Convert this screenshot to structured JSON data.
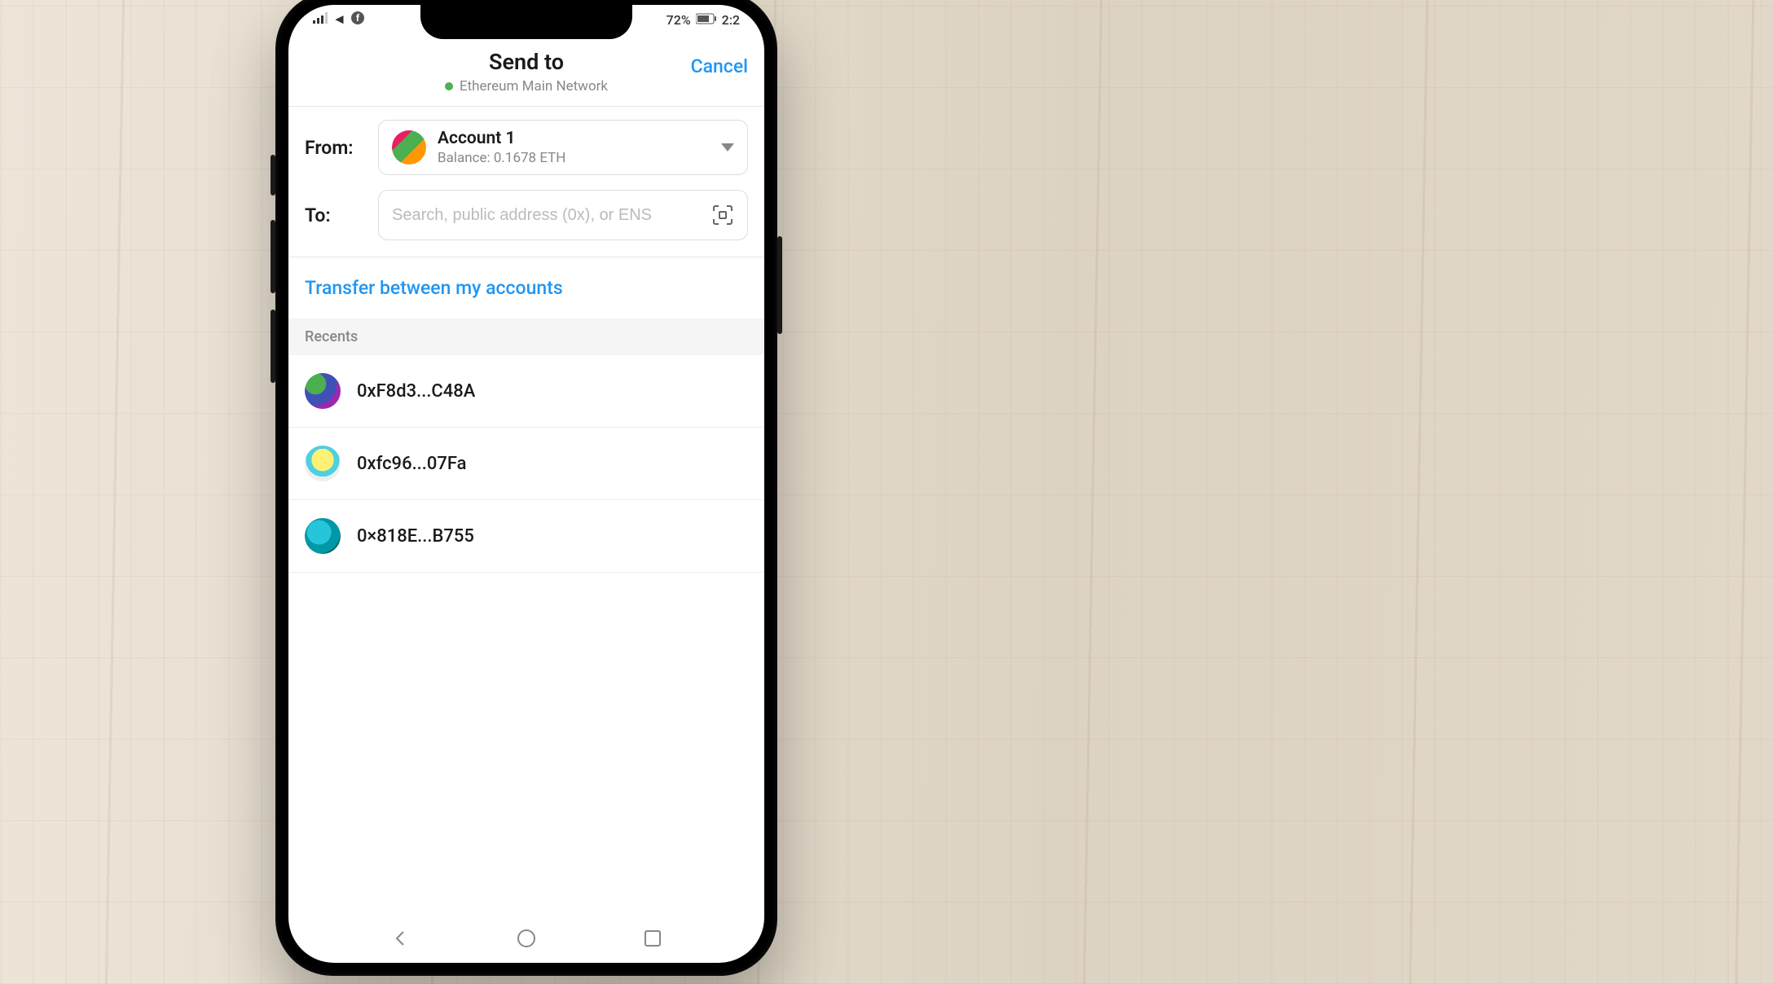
{
  "statusBar": {
    "battery": "72%",
    "time": "2:2"
  },
  "header": {
    "title": "Send to",
    "network": "Ethereum Main Network",
    "cancel": "Cancel"
  },
  "form": {
    "fromLabel": "From:",
    "toLabel": "To:",
    "account": {
      "name": "Account 1",
      "balance": "Balance: 0.1678 ETH"
    },
    "toPlaceholder": "Search, public address (0x), or ENS"
  },
  "transferLink": "Transfer between my accounts",
  "recents": {
    "header": "Recents",
    "items": [
      {
        "address": "0xF8d3...C48A"
      },
      {
        "address": "0xfc96...07Fa"
      },
      {
        "address": "0×818E...B755"
      }
    ]
  }
}
